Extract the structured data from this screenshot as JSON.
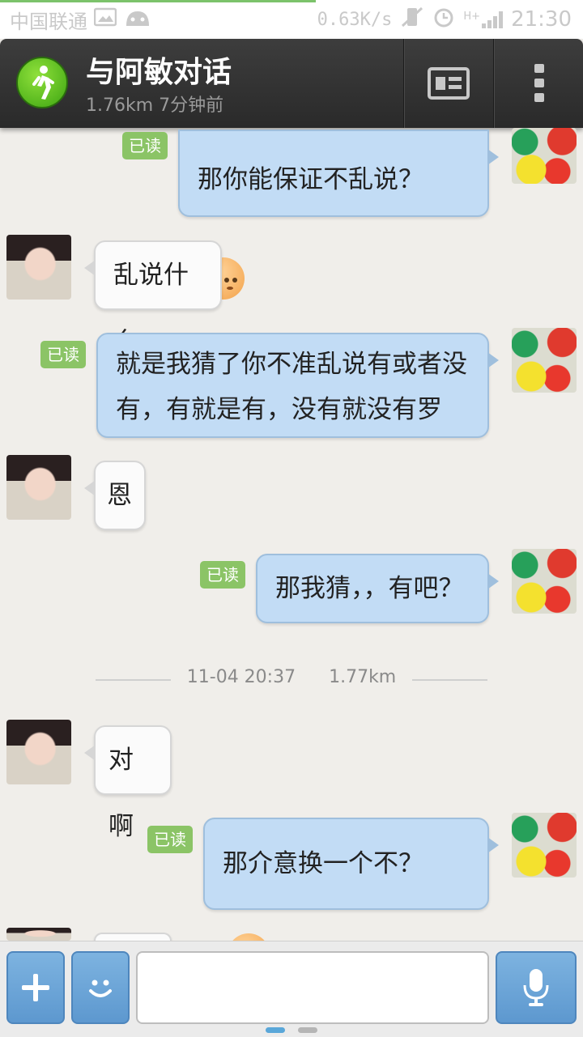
{
  "status_bar": {
    "carrier": "中国联通",
    "speed": "0.63K/s",
    "network": "H+",
    "time": "21:30"
  },
  "header": {
    "title": "与阿敏对话",
    "subtitle": "1.76km 7分钟前"
  },
  "messages": [
    {
      "side": "out",
      "text": "那你能保证不乱说？",
      "read_label": "已读",
      "emoji": "confused-face"
    },
    {
      "side": "in",
      "text": "乱说什么"
    },
    {
      "side": "out",
      "text_line1": "就是我猜了你不准乱说有或者没",
      "text_line2": "有，有就是有，没有就没有罗",
      "read_label": "已读"
    },
    {
      "side": "in",
      "text": "恩"
    },
    {
      "side": "out",
      "text": "那我猜，，有吧？",
      "read_label": "已读"
    },
    {
      "side": "in",
      "text": "对啊"
    },
    {
      "side": "out",
      "text": "那介意换一个不？",
      "read_label": "已读",
      "emoji": "shy-face"
    }
  ],
  "divider": {
    "timestamp": "11-04 20:37",
    "distance": "1.77km"
  },
  "input": {
    "placeholder": ""
  },
  "colors": {
    "outgoing_bubble": "#c2dcf5",
    "incoming_bubble": "#fbfbfb",
    "read_badge": "#8bc466",
    "header": "#2f2f2f",
    "input_buttons": "#6ba5d8"
  }
}
